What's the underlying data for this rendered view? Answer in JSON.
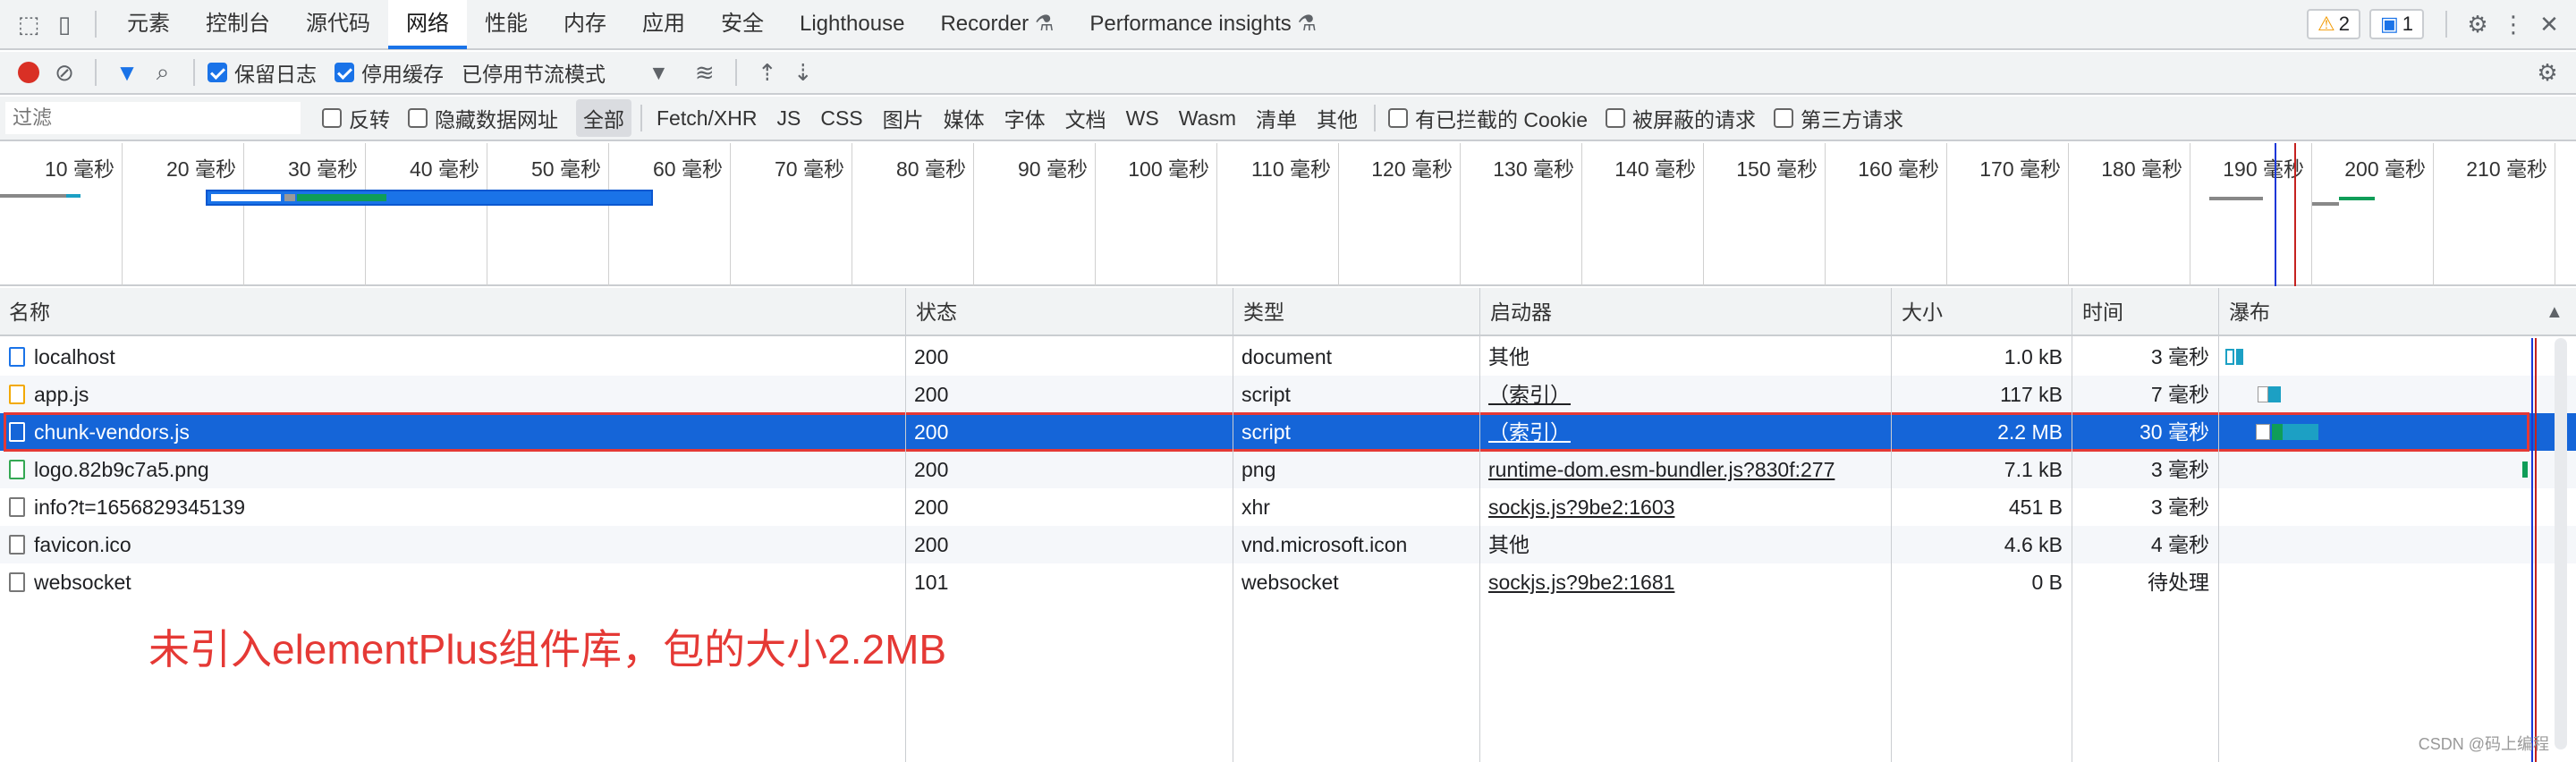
{
  "tabs": [
    "元素",
    "控制台",
    "源代码",
    "网络",
    "性能",
    "内存",
    "应用",
    "安全",
    "Lighthouse",
    "Recorder",
    "Performance insights"
  ],
  "active_tab": "网络",
  "badges": {
    "warnings": "2",
    "messages": "1"
  },
  "toolbar": {
    "preserve_log": "保留日志",
    "disable_cache": "停用缓存",
    "throttling": "已停用节流模式"
  },
  "filter": {
    "placeholder": "过滤",
    "invert": "反转",
    "hide_data_urls": "隐藏数据网址",
    "types": [
      "全部",
      "Fetch/XHR",
      "JS",
      "CSS",
      "图片",
      "媒体",
      "字体",
      "文档",
      "WS",
      "Wasm",
      "清单",
      "其他"
    ],
    "blocked_cookies": "有已拦截的 Cookie",
    "blocked_requests": "被屏蔽的请求",
    "third_party": "第三方请求"
  },
  "timeline_ticks": [
    "10 毫秒",
    "20 毫秒",
    "30 毫秒",
    "40 毫秒",
    "50 毫秒",
    "60 毫秒",
    "70 毫秒",
    "80 毫秒",
    "90 毫秒",
    "100 毫秒",
    "110 毫秒",
    "120 毫秒",
    "130 毫秒",
    "140 毫秒",
    "150 毫秒",
    "160 毫秒",
    "170 毫秒",
    "180 毫秒",
    "190 毫秒",
    "200 毫秒",
    "210 毫秒"
  ],
  "columns": {
    "name": "名称",
    "status": "状态",
    "type": "类型",
    "initiator": "启动器",
    "size": "大小",
    "time": "时间",
    "waterfall": "瀑布"
  },
  "rows": [
    {
      "name": "localhost",
      "status": "200",
      "type": "document",
      "initiator": "其他",
      "size": "1.0 kB",
      "time": "3 毫秒",
      "icon": "document-icon"
    },
    {
      "name": "app.js",
      "status": "200",
      "type": "script",
      "initiator": "（索引）",
      "size": "117 kB",
      "time": "7 毫秒",
      "icon": "script-icon"
    },
    {
      "name": "chunk-vendors.js",
      "status": "200",
      "type": "script",
      "initiator": "（索引）",
      "size": "2.2 MB",
      "time": "30 毫秒",
      "icon": "script-icon"
    },
    {
      "name": "logo.82b9c7a5.png",
      "status": "200",
      "type": "png",
      "initiator": "runtime-dom.esm-bundler.js?830f:277",
      "size": "7.1 kB",
      "time": "3 毫秒",
      "icon": "image-icon"
    },
    {
      "name": "info?t=1656829345139",
      "status": "200",
      "type": "xhr",
      "initiator": "sockjs.js?9be2:1603",
      "size": "451 B",
      "time": "3 毫秒",
      "icon": "file-icon"
    },
    {
      "name": "favicon.ico",
      "status": "200",
      "type": "vnd.microsoft.icon",
      "initiator": "其他",
      "size": "4.6 kB",
      "time": "4 毫秒",
      "icon": "file-icon"
    },
    {
      "name": "websocket",
      "status": "101",
      "type": "websocket",
      "initiator": "sockjs.js?9be2:1681",
      "size": "0 B",
      "time": "待处理",
      "icon": "file-icon"
    }
  ],
  "annotation": "未引入elementPlus组件库，包的大小2.2MB",
  "watermark": "CSDN @码上编程"
}
